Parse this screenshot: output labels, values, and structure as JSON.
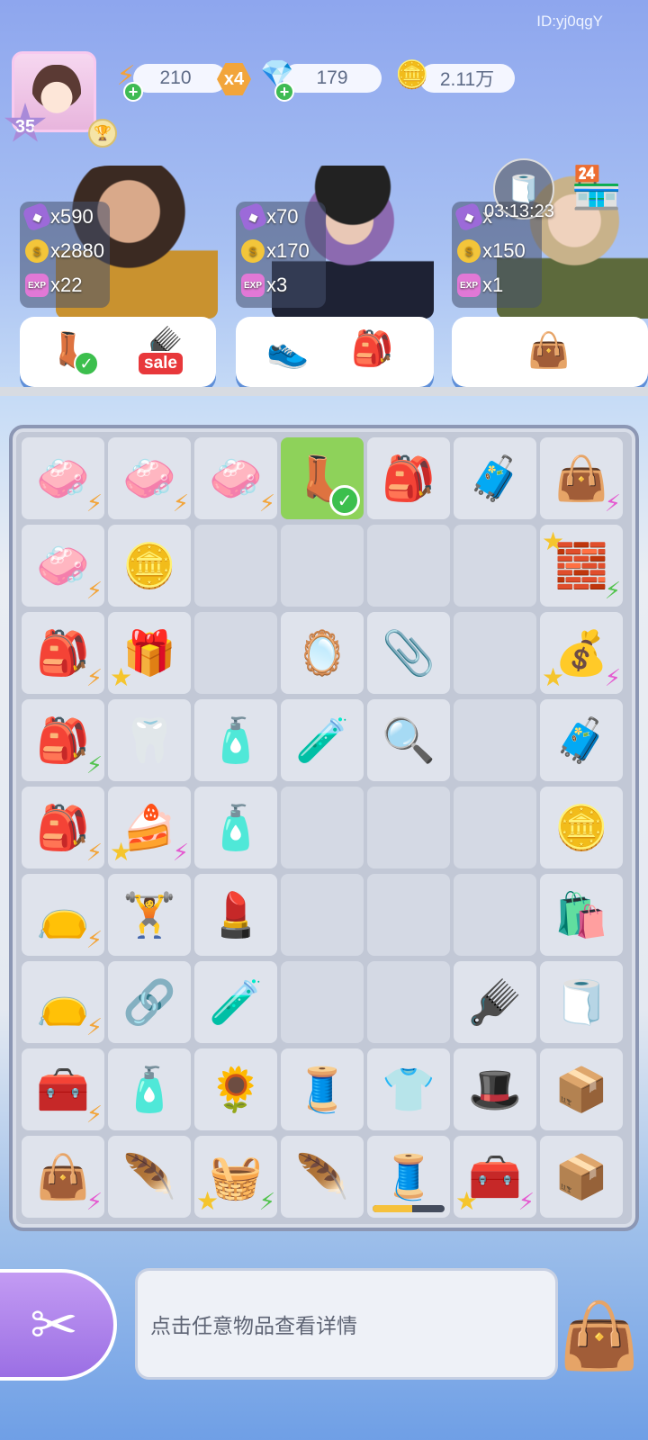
{
  "header": {
    "player_id": "ID:yj0qgY",
    "level": "35",
    "energy": "210",
    "energy_multiplier": "x4",
    "gems": "179",
    "coins": "2.11万"
  },
  "characters": [
    {
      "gems": "x590",
      "coins": "x2880",
      "exp": "x22",
      "order_sale": "sale"
    },
    {
      "gems": "x70",
      "coins": "x170",
      "exp": "x3"
    },
    {
      "gems": "x",
      "coins": "x150",
      "exp": "x1",
      "timer": "03:13:23"
    }
  ],
  "board": {
    "rows": [
      [
        "🧼",
        "🧼",
        "🧼",
        "👢",
        "🎒",
        "🧳",
        "👜"
      ],
      [
        "🧼",
        "🪙",
        "",
        "",
        "",
        "",
        "🧱"
      ],
      [
        "🎒",
        "🎁",
        "",
        "🪞",
        "📎",
        "",
        "💰"
      ],
      [
        "🎒",
        "🦷",
        "🧴",
        "🧪",
        "🔍",
        "",
        "🧳"
      ],
      [
        "🎒",
        "🍰",
        "🧴",
        "",
        "",
        "",
        "🪙"
      ],
      [
        "👝",
        "🏋️",
        "💄",
        "",
        "",
        "",
        "🛍️"
      ],
      [
        "👝",
        "🔗",
        "🧪",
        "",
        "",
        "🪮",
        "🧻"
      ],
      [
        "🧰",
        "🧴",
        "🌻",
        "🧵",
        "👕",
        "🎩",
        "📦"
      ],
      [
        "👜",
        "🪶",
        "🧺",
        "🪶",
        "🧵",
        "🧰",
        "📦"
      ]
    ],
    "sewing_machine_progress": 0.55
  },
  "bottom": {
    "info_text": "点击任意物品查看详情"
  }
}
